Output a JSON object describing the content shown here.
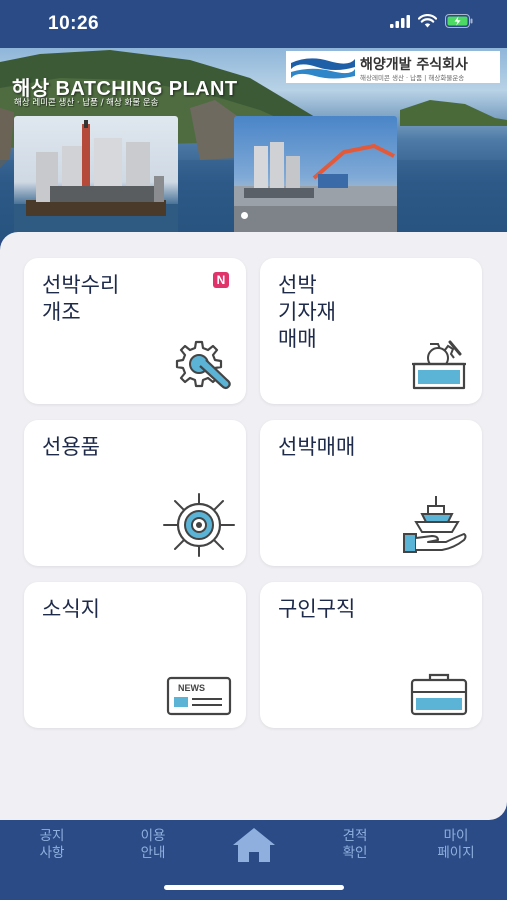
{
  "status_bar": {
    "time": "10:26"
  },
  "banner": {
    "title": "해상 BATCHING PLANT",
    "subtitle": "해상 레미콘 생산 · 납품 / 해상 화물 운송",
    "company": {
      "name": "해양개발 주식회사",
      "sub": "해상레미콘 생산 · 납품 | 해상화물운송"
    },
    "carousel": {
      "current": 1
    }
  },
  "menu": [
    {
      "label": "선박수리\n개조",
      "icon": "wrench-gear-icon",
      "badge": "N"
    },
    {
      "label": "선박\n기자재\n매매",
      "icon": "equipment-box-icon"
    },
    {
      "label": "선용품",
      "icon": "ship-wheel-icon"
    },
    {
      "label": "선박매매",
      "icon": "ship-in-hand-icon"
    },
    {
      "label": "소식지",
      "icon": "news-icon"
    },
    {
      "label": "구인구직",
      "icon": "briefcase-icon"
    }
  ],
  "bottom_nav": [
    {
      "label": "공지\n사항"
    },
    {
      "label": "이용\n안내"
    },
    {
      "label": "",
      "icon": "home-icon"
    },
    {
      "label": "견적\n확인"
    },
    {
      "label": "마이\n페이지"
    }
  ],
  "colors": {
    "primary": "#2b4b86",
    "accent": "#5bb3d6",
    "badge": "#e0336c",
    "background": "#f0f0f4"
  }
}
